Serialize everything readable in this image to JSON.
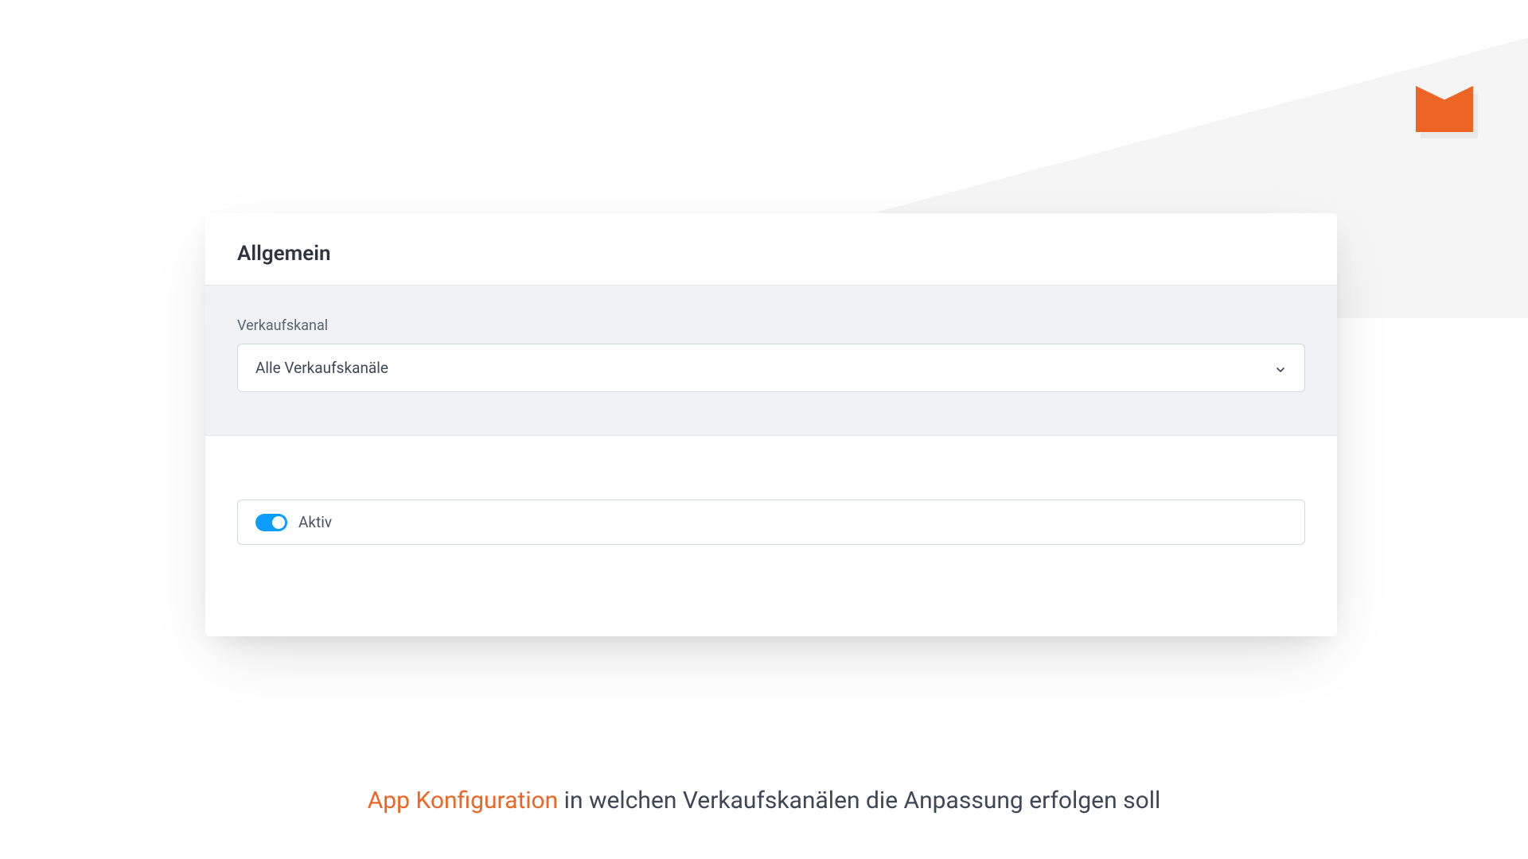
{
  "card": {
    "title": "Allgemein",
    "sales_channel": {
      "label": "Verkaufskanal",
      "selected": "Alle Verkaufskanäle"
    },
    "active_toggle": {
      "label": "Aktiv",
      "value": true
    }
  },
  "caption": {
    "highlight": "App Konfiguration",
    "rest": " in welchen Verkaufskanälen die Anpassung erfolgen soll"
  },
  "colors": {
    "accent": "#ec6524",
    "toggle_on": "#0b9dff"
  }
}
